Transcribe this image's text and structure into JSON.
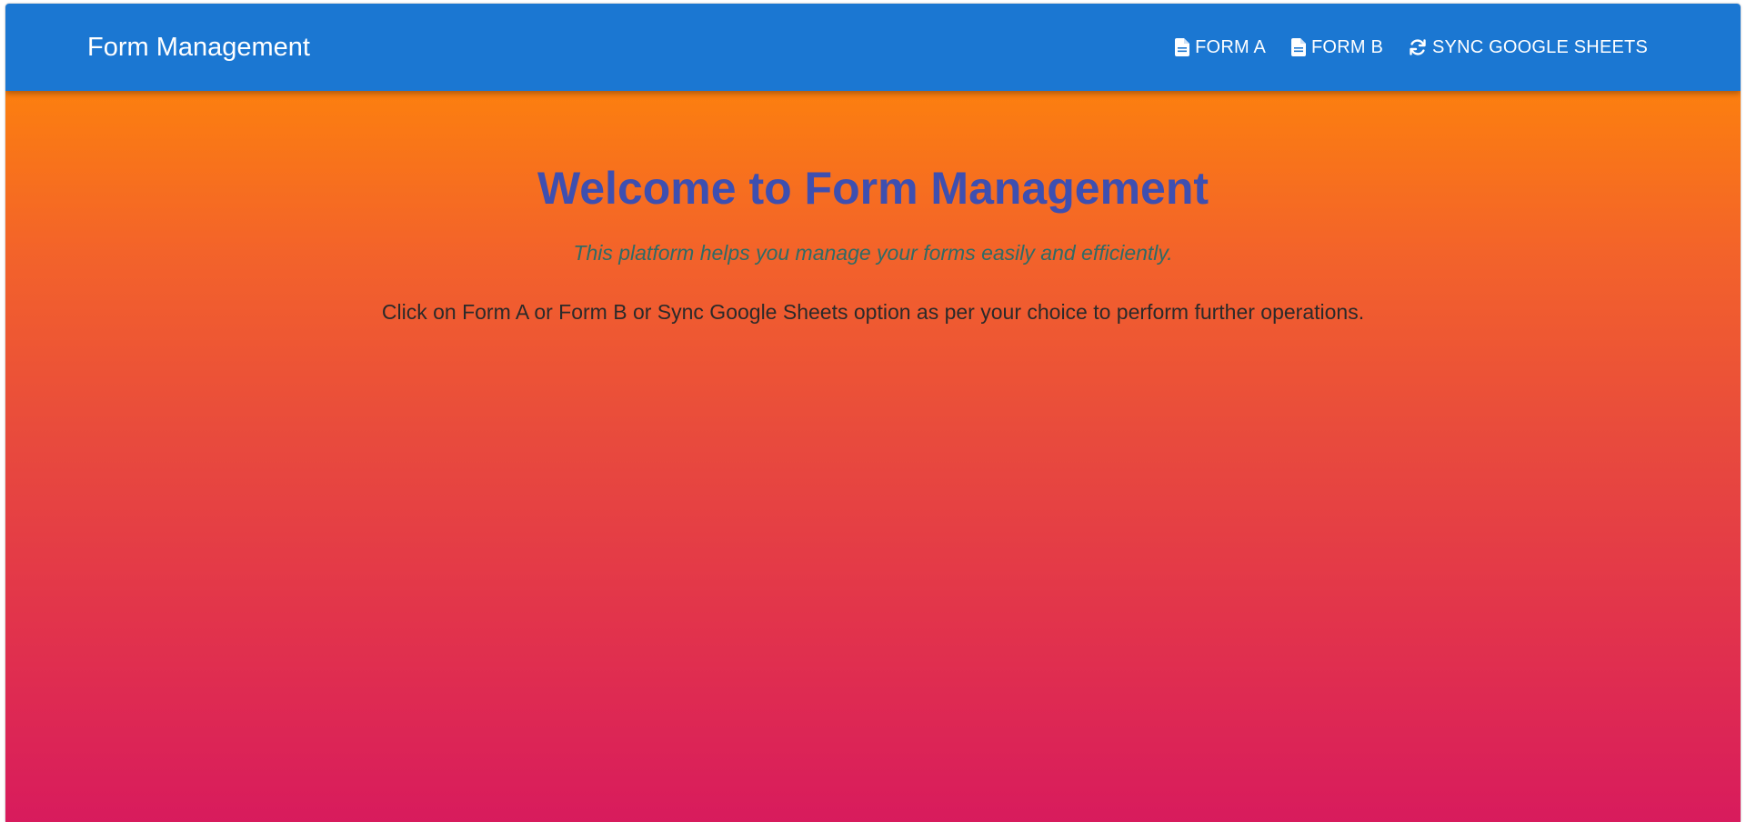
{
  "appbar": {
    "title": "Form Management",
    "background": "#1b77d2",
    "nav": [
      {
        "label": "FORM A",
        "icon": "file-icon"
      },
      {
        "label": "FORM B",
        "icon": "file-icon"
      },
      {
        "label": "SYNC GOOGLE SHEETS",
        "icon": "sync-icon"
      }
    ]
  },
  "main": {
    "headline": "Welcome to Form Management",
    "subtitle": "This platform helps you manage your forms easily and efficiently.",
    "instruction": "Click on Form A or Form B or Sync Google Sheets option as per your choice to perform further operations.",
    "gradient_top": "#fc7f0f",
    "gradient_bottom": "#d81b5d",
    "headline_color": "#3e4fb0",
    "subtitle_color": "#2f6b66"
  }
}
